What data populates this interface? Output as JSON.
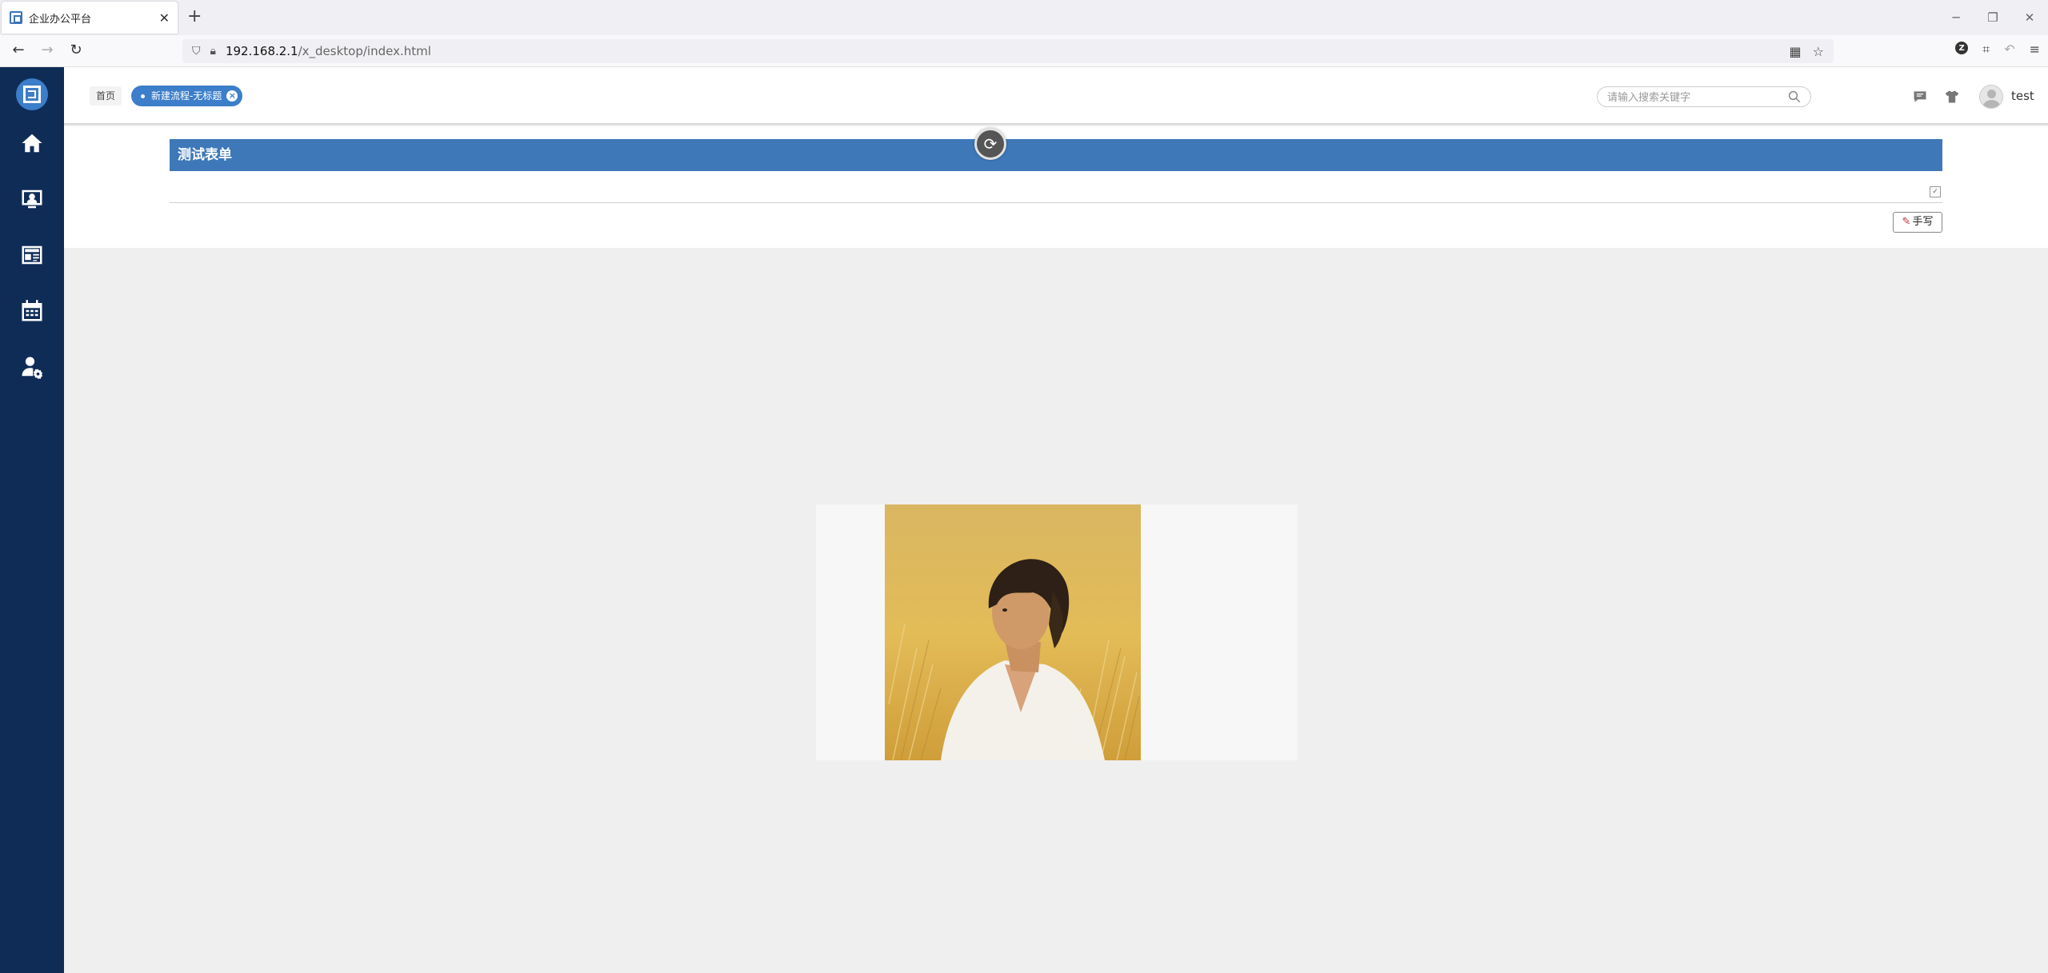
{
  "browser": {
    "tab_title": "企业办公平台",
    "tab_close": "✕",
    "new_tab": "+",
    "url_host": "192.168.2.1",
    "url_path": "/x_desktop/index.html",
    "window_controls": [
      "─",
      "❐",
      "✕"
    ]
  },
  "header": {
    "home_tab": "首页",
    "active_tab": "新建流程-无标题",
    "search_placeholder": "请输入搜索关键字",
    "username": "test"
  },
  "sidebar": {
    "items": [
      {
        "icon": "home-icon"
      },
      {
        "icon": "person-board-icon"
      },
      {
        "icon": "news-icon"
      },
      {
        "icon": "calendar-icon"
      },
      {
        "icon": "user-settings-icon"
      }
    ]
  },
  "form": {
    "title": "测试表单",
    "handwrite_label": "手写"
  },
  "colors": {
    "sidebar": "#0f2c57",
    "accent": "#3c7ec9",
    "form_title_bar": "#3e78b8"
  }
}
